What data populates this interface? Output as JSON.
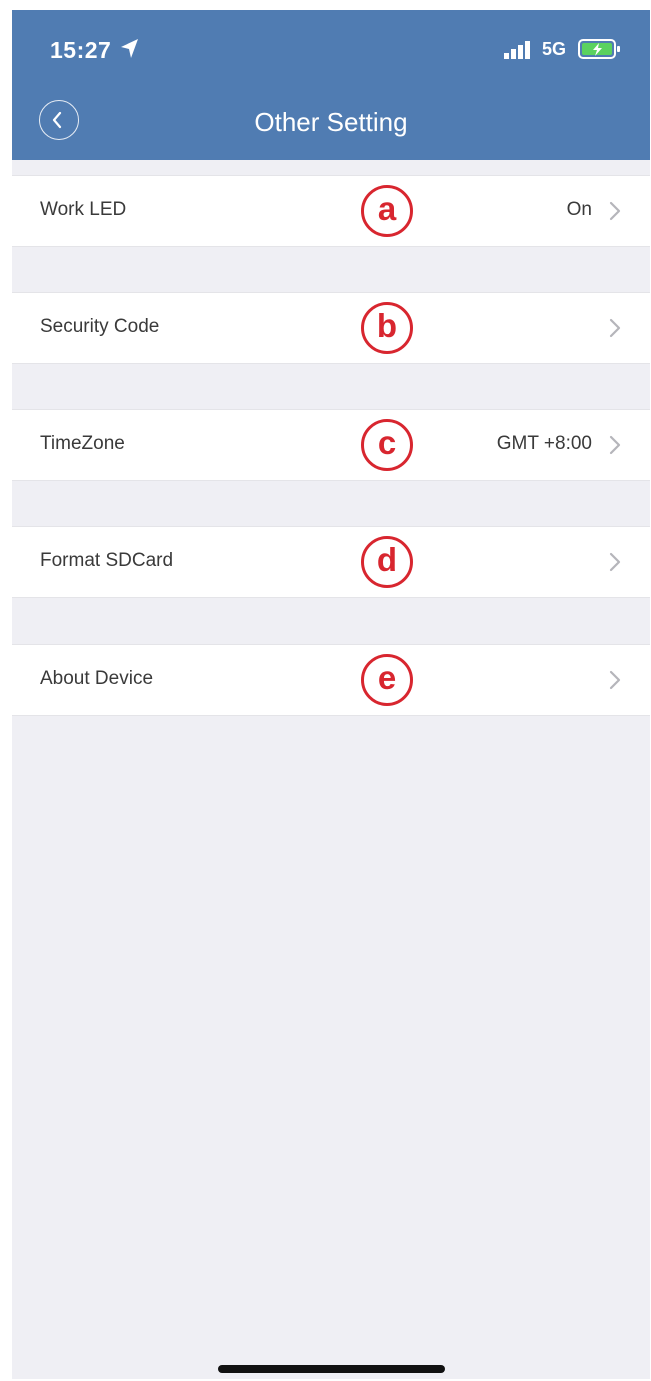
{
  "status_bar": {
    "time": "15:27",
    "network": "5G",
    "icons": [
      "location-arrow-icon",
      "signal-icon",
      "battery-charging-icon"
    ]
  },
  "header": {
    "title": "Other Setting",
    "back_icon": "chevron-left-icon"
  },
  "settings": [
    {
      "label": "Work LED",
      "value": "On",
      "marker": "a"
    },
    {
      "label": "Security Code",
      "value": "",
      "marker": "b"
    },
    {
      "label": "TimeZone",
      "value": "GMT +8:00",
      "marker": "c"
    },
    {
      "label": "Format SDCard",
      "value": "",
      "marker": "d"
    },
    {
      "label": "About Device",
      "value": "",
      "marker": "e"
    }
  ],
  "colors": {
    "header": "#507cb2",
    "background": "#efeff4",
    "marker": "#d8262f"
  }
}
